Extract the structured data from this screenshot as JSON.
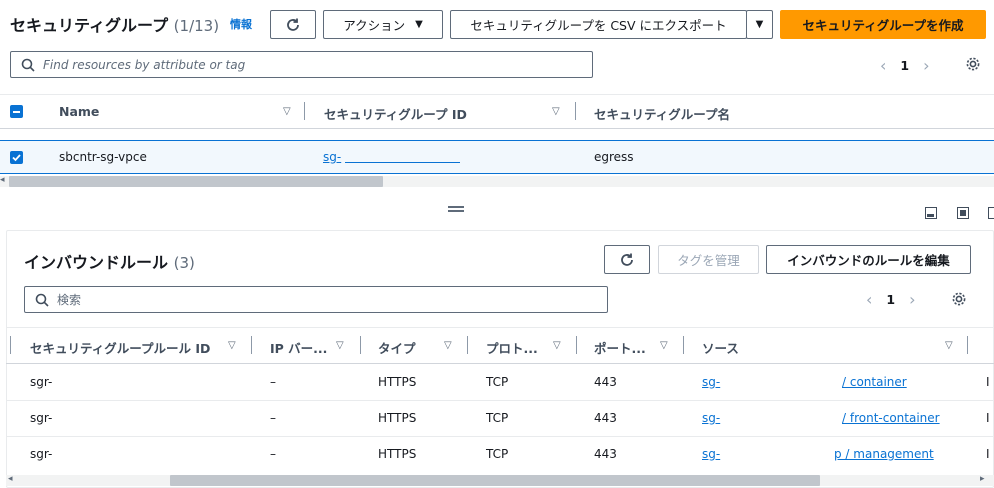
{
  "top": {
    "title": "セキュリティグループ",
    "count": "(1/13)",
    "info": "情報",
    "actions_label": "アクション",
    "export_label": "セキュリティグループを CSV にエクスポート",
    "create_label": "セキュリティグループを作成",
    "search_placeholder": "Find resources by attribute or tag",
    "page": "1",
    "columns": [
      "Name",
      "セキュリティグループ ID",
      "セキュリティグループ名"
    ],
    "row": {
      "name": "sbcntr-sg-vpce",
      "id": "sg-",
      "group_name": "egress"
    }
  },
  "bottom": {
    "title": "インバウンドルール",
    "count": "(3)",
    "manage_tags_label": "タグを管理",
    "edit_label": "インバウンドのルールを編集",
    "search_placeholder": "検索",
    "page": "1",
    "columns": [
      "セキュリティグループルール ID",
      "IP バー...",
      "タイプ",
      "プロト...",
      "ポート...",
      "ソース"
    ],
    "rows": [
      {
        "id": "sgr-",
        "ip": "–",
        "type": "HTTPS",
        "proto": "TCP",
        "port": "443",
        "src_prefix": "sg-",
        "src_suffix": "/ container",
        "last": "I"
      },
      {
        "id": "sgr-",
        "ip": "–",
        "type": "HTTPS",
        "proto": "TCP",
        "port": "443",
        "src_prefix": "sg-",
        "src_suffix": "/ front-container",
        "last": "I"
      },
      {
        "id": "sgr-",
        "ip": "–",
        "type": "HTTPS",
        "proto": "TCP",
        "port": "443",
        "src_prefix": "sg-",
        "src_suffix": "p / management",
        "last": "I"
      }
    ]
  }
}
